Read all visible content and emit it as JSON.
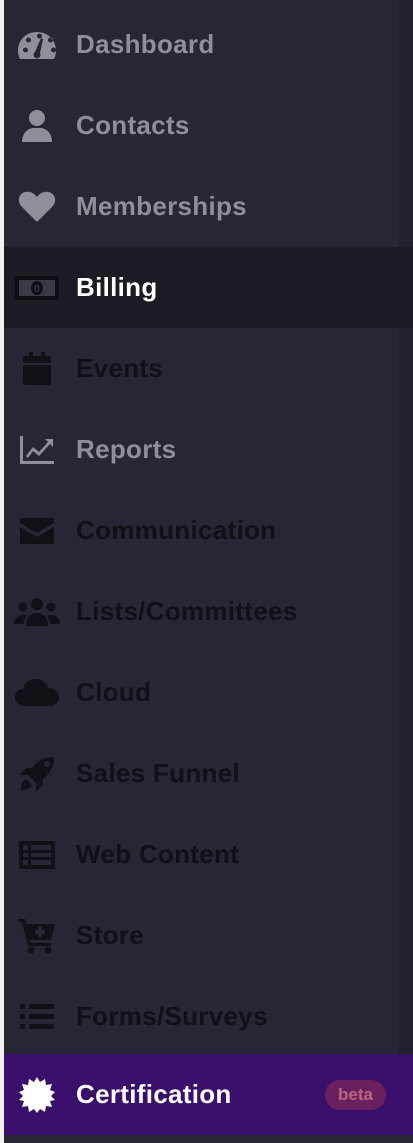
{
  "nav": {
    "items": [
      {
        "label": "Dashboard",
        "icon": "dashboard-gauge-icon"
      },
      {
        "label": "Contacts",
        "icon": "user-icon"
      },
      {
        "label": "Memberships",
        "icon": "heart-icon"
      },
      {
        "label": "Billing",
        "icon": "money-bill-icon",
        "active": true
      },
      {
        "label": "Events",
        "icon": "calendar-icon"
      },
      {
        "label": "Reports",
        "icon": "line-chart-icon"
      },
      {
        "label": "Communication",
        "icon": "envelope-icon"
      },
      {
        "label": "Lists/Committees",
        "icon": "users-group-icon"
      },
      {
        "label": "Cloud",
        "icon": "cloud-icon"
      },
      {
        "label": "Sales Funnel",
        "icon": "rocket-icon"
      },
      {
        "label": "Web Content",
        "icon": "list-alt-icon"
      },
      {
        "label": "Store",
        "icon": "cart-plus-icon"
      },
      {
        "label": "Forms/Surveys",
        "icon": "list-icon"
      },
      {
        "label": "Certification",
        "icon": "certificate-icon",
        "badge": "beta"
      }
    ]
  },
  "colors": {
    "sidebar_bg": "#262634",
    "active_bg": "#1b1b24",
    "certification_bg": "#3a0f6b",
    "badge_bg": "#6a1f5f"
  }
}
